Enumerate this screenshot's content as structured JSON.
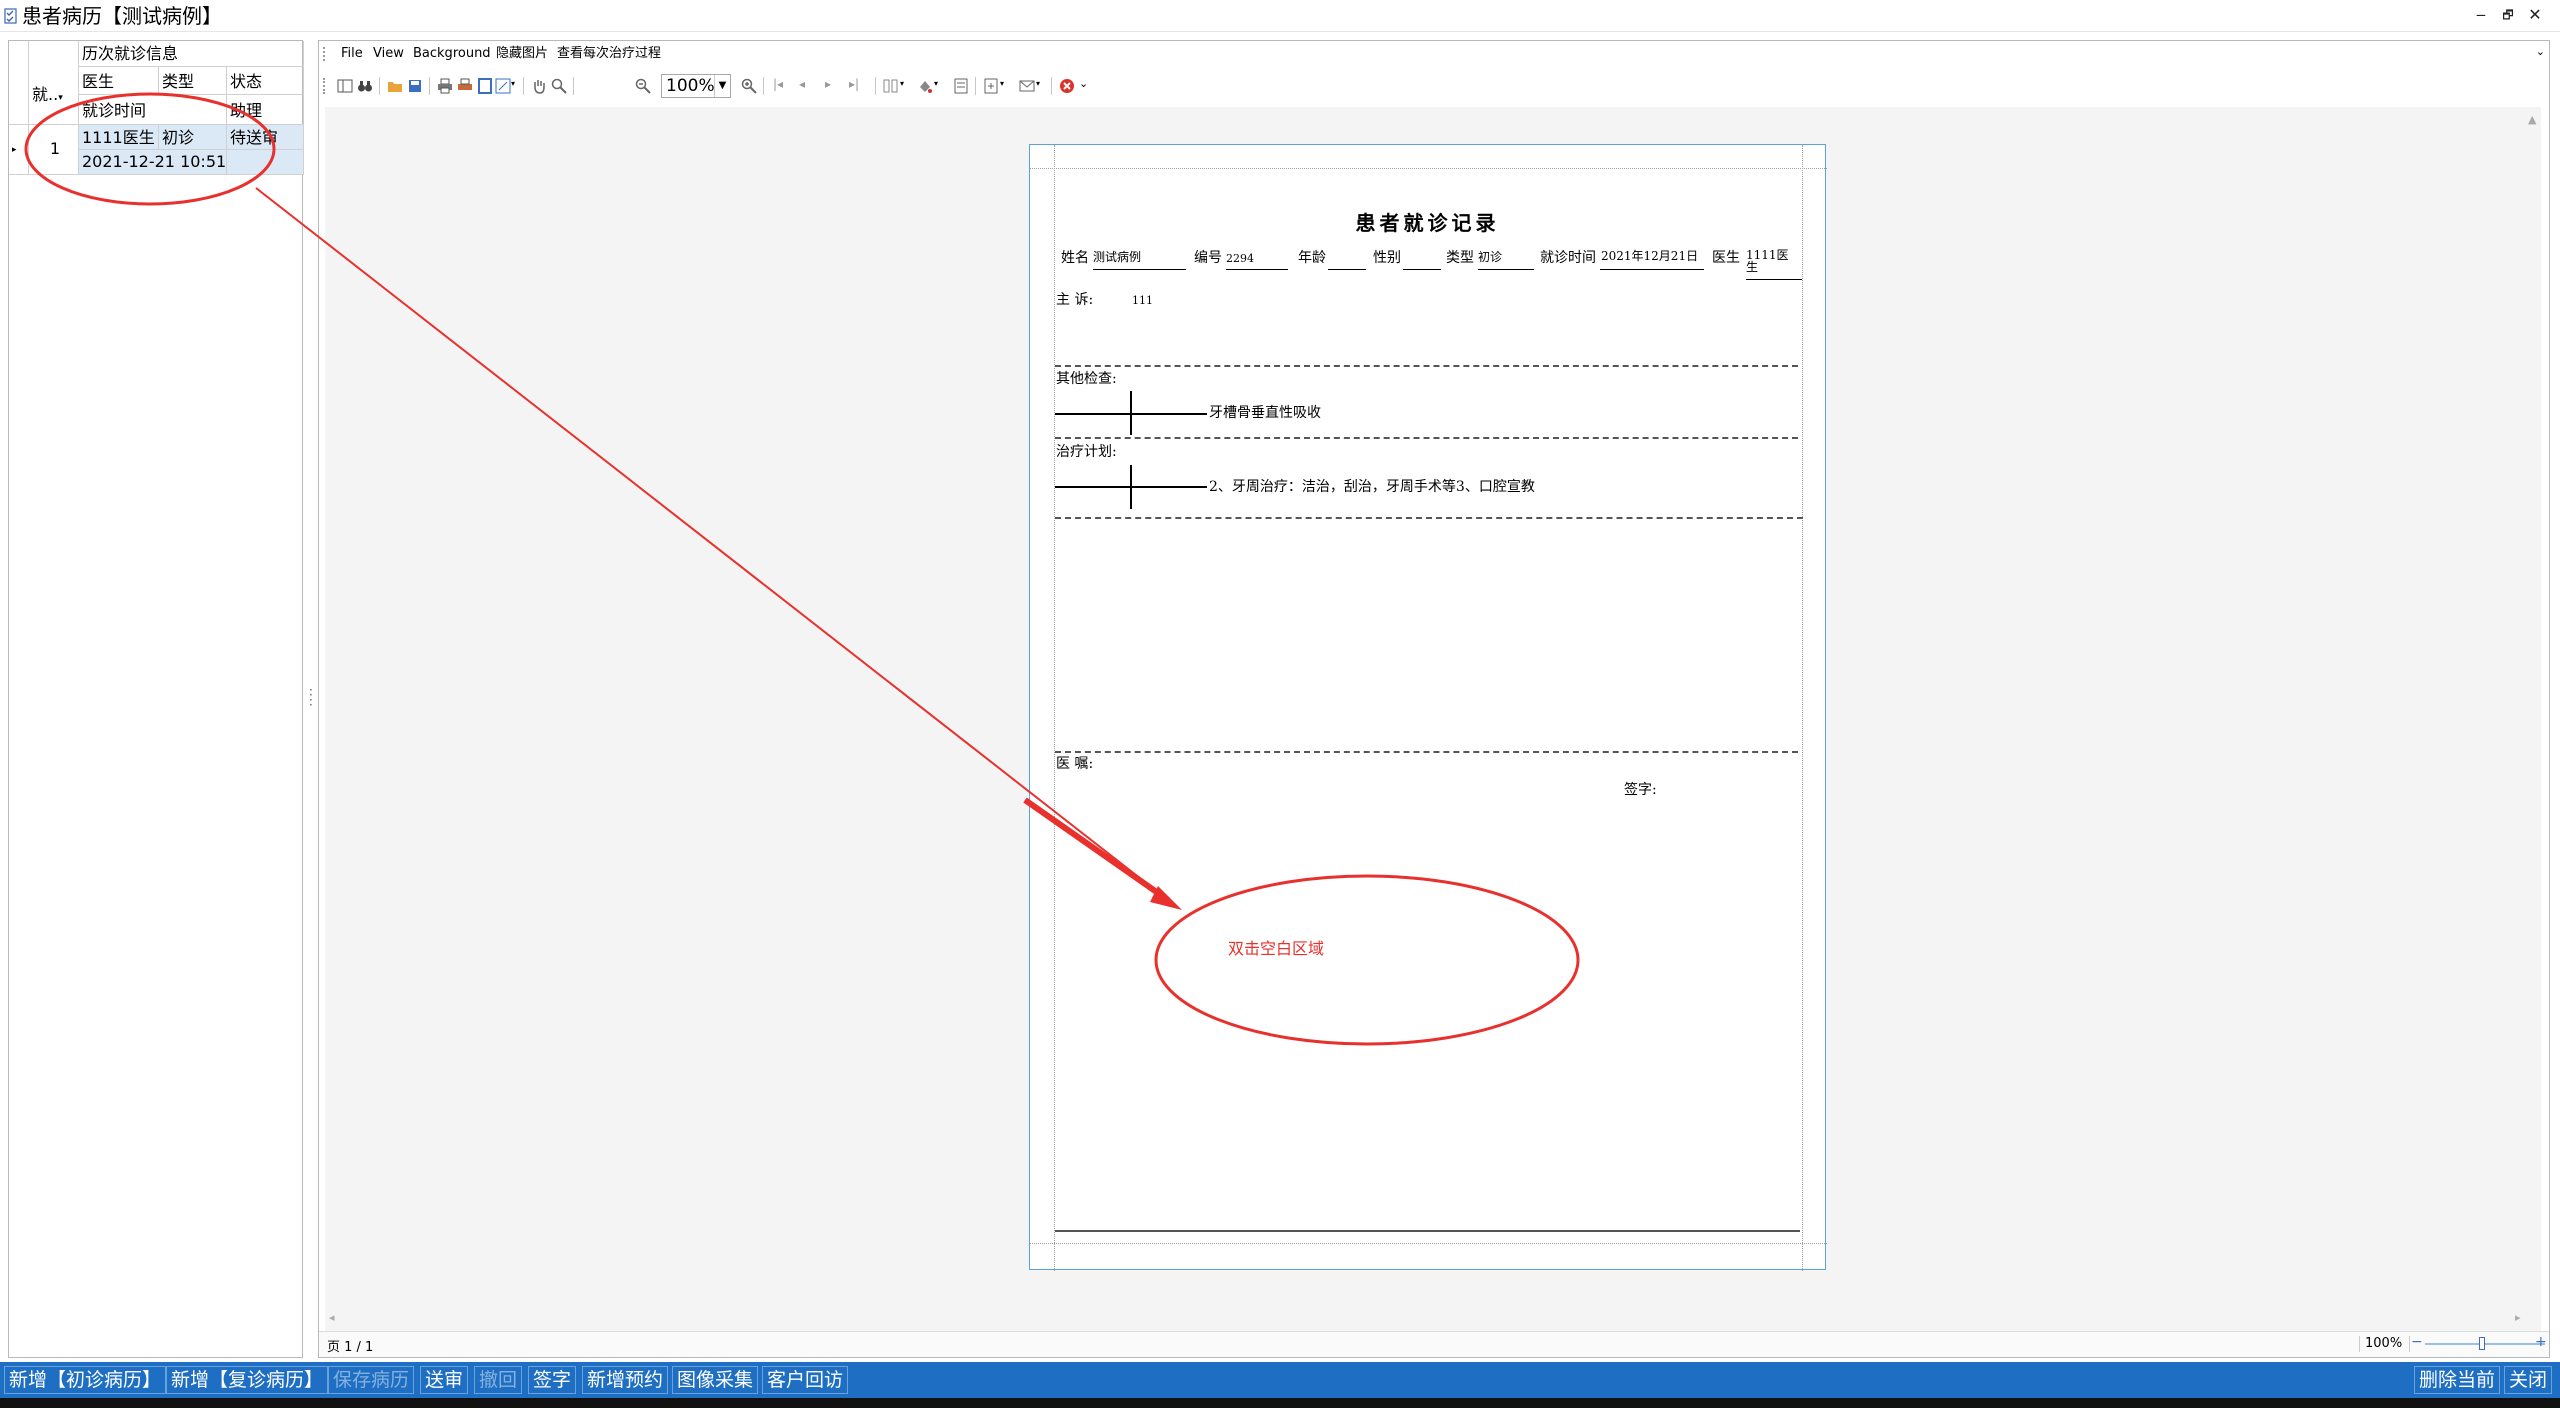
{
  "window": {
    "title": "患者病历【测试病例】",
    "minimize": "‒",
    "restore": "🗗",
    "close": "✕"
  },
  "history_panel": {
    "group_header": "历次就诊信息",
    "col_visit": "就..",
    "col_doctor": "医生",
    "col_type": "类型",
    "col_status": "状态",
    "col_time": "就诊时间",
    "col_assistant": "助理",
    "rows": [
      {
        "index": "1",
        "doctor": "1111医生",
        "type": "初诊",
        "status": "待送审",
        "time": "2021-12-21 10:51",
        "assistant": ""
      }
    ]
  },
  "viewer": {
    "menu": {
      "file": "File",
      "view": "View",
      "background": "Background",
      "hide_images": "隐藏图片",
      "view_process": "查看每次治疗过程"
    },
    "zoom": "100%",
    "status_page": "页 1 / 1",
    "status_zoom": "100%"
  },
  "document": {
    "title": "患者就诊记录",
    "name_label": "姓名",
    "name_value": "测试病例",
    "id_label": "编号",
    "id_value": "2294",
    "age_label": "年龄",
    "age_value": "",
    "sex_label": "性别",
    "sex_value": "",
    "type_label": "类型",
    "type_value": "初诊",
    "visit_time_label": "就诊时间",
    "visit_time_value": "2021年12月21日",
    "doctor_label": "医生",
    "doctor_value_line1": "1111医",
    "doctor_value_line2": "生",
    "complaint_label": "主 诉:",
    "complaint_value": "111",
    "other_exam_label": "其他检查:",
    "other_exam_value": "牙槽骨垂直性吸收",
    "plan_label": "治疗计划:",
    "plan_value": "2、牙周治疗：洁治，刮治，牙周手术等3、口腔宣教",
    "advice_label": "医 嘱:",
    "signature_label": "签字:"
  },
  "annotation": {
    "hint_text": "双击空白区域",
    "color": "#e8302c"
  },
  "bottom_bar": {
    "new_initial": "新增【初诊病历】",
    "new_followup": "新增【复诊病历】",
    "save": "保存病历",
    "submit": "送审",
    "withdraw": "撤回",
    "sign": "签字",
    "new_appointment": "新增预约",
    "image_capture": "图像采集",
    "customer_callback": "客户回访",
    "delete_current": "删除当前",
    "close": "关闭"
  },
  "colors": {
    "bottom_bar_bg": "#1e6fc3",
    "selected_row": "#dbe8f6",
    "page_border": "#5ba3d8"
  }
}
